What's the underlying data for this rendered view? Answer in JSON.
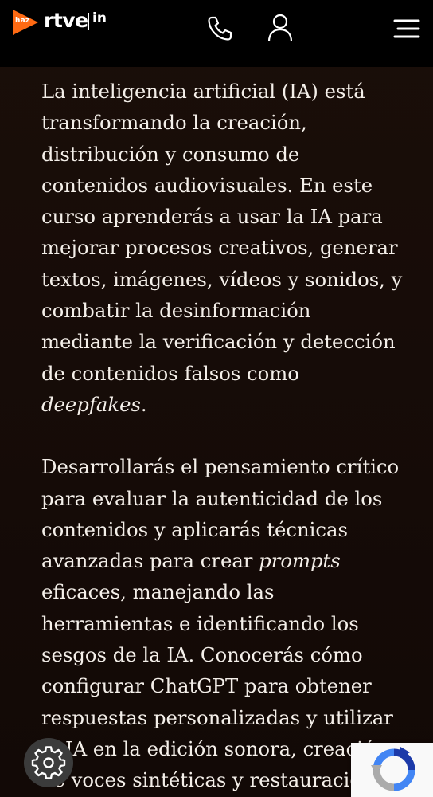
{
  "header": {
    "logo_haz": "haz",
    "logo_rtve": "rtve",
    "logo_in": "in",
    "phone_icon": "phone-icon",
    "user_icon": "user-icon",
    "menu_icon": "hamburger-menu-icon"
  },
  "content": {
    "p1_text": "La inteligencia artificial (IA) está transformando la creación, distribución y consumo de contenidos audiovisuales. En este curso aprenderás a usar la IA para mejorar procesos creativos, generar textos, imágenes, vídeos y sonidos, y combatir la desinformación mediante la verificación y detección de contenidos falsos como ",
    "p1_em": "deepfakes",
    "p1_end": ".",
    "p2_text_a": "Desarrollarás el pensamiento crítico para evaluar la autenticidad de los contenidos y aplicarás técnicas avanzadas para crear ",
    "p2_em": "prompts",
    "p2_text_b": " eficaces, manejando las herramientas e identificando los sesgos de la IA. Conocerás cómo configurar ChatGPT para obtener respuestas personalizadas y utilizar la IA en la edición sonora, creación de voces sintéticas y restauración"
  },
  "floating": {
    "settings_icon": "gear-icon",
    "recaptcha_icon": "recaptcha-icon"
  },
  "colors": {
    "header_bg": "#000000",
    "page_bg": "#140b07",
    "text": "#f4efe9",
    "brand_orange": "#ff6a13"
  }
}
